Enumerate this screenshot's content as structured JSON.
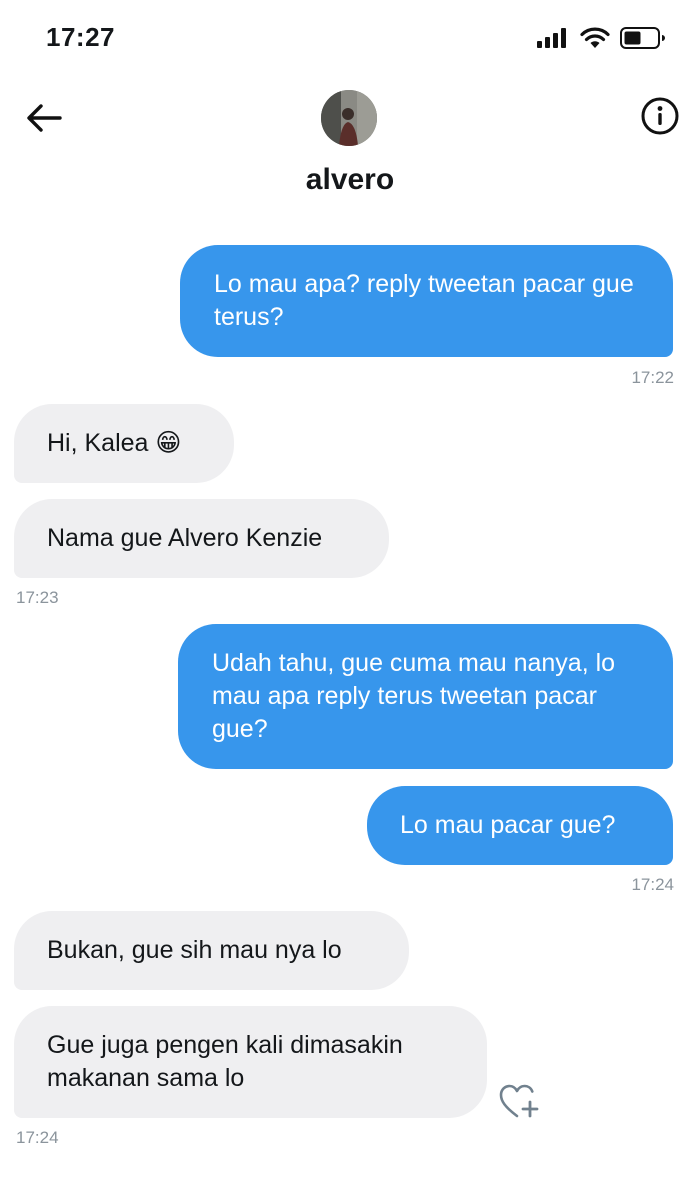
{
  "status_bar": {
    "time": "17:27",
    "icons": [
      "signal-icon",
      "wifi-icon",
      "battery-icon"
    ]
  },
  "header": {
    "name": "alvero",
    "back_icon": "arrow-left-icon",
    "info_icon": "info-icon"
  },
  "messages": [
    {
      "direction": "outgoing",
      "text": "Lo mau apa? reply tweetan pacar gue terus?"
    },
    {
      "direction": "incoming",
      "text": "Hi, Kalea 😁"
    },
    {
      "direction": "incoming",
      "text": "Nama gue Alvero Kenzie"
    },
    {
      "direction": "outgoing",
      "text": "Udah tahu, gue cuma mau nanya, lo mau apa reply terus tweetan pacar gue?"
    },
    {
      "direction": "outgoing",
      "text": "Lo mau pacar gue?"
    },
    {
      "direction": "incoming",
      "text": "Bukan, gue sih mau nya lo"
    },
    {
      "direction": "incoming",
      "text": "Gue juga pengen kali dimasakin makanan sama lo"
    }
  ],
  "timestamps": [
    "17:22",
    "17:23",
    "17:24",
    "17:24"
  ],
  "colors": {
    "outgoing_bubble": "#3796ec",
    "incoming_bubble": "#efeff1",
    "timestamp": "#8b949c"
  }
}
